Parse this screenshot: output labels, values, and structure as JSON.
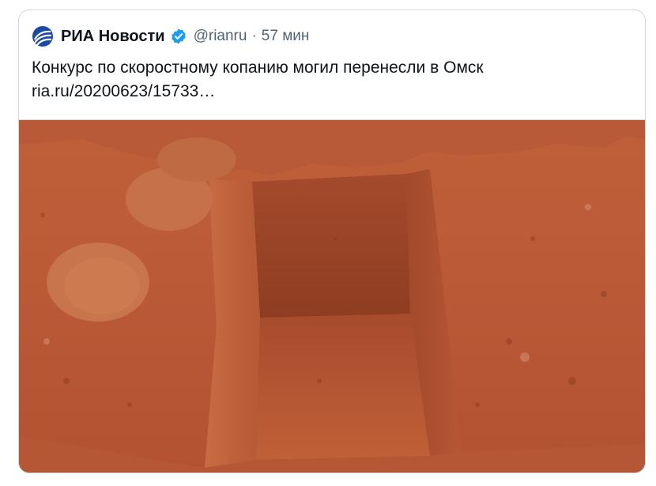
{
  "tweet": {
    "author_name": "РИА Новости",
    "author_handle": "@rianru",
    "separator": "·",
    "timestamp": "57 мин",
    "text_line1": "Конкурс по скоростному копанию могил перенесли в Омск",
    "text_line2": "ria.ru/20200623/15733…",
    "verified_icon": "verified-badge-icon",
    "avatar_icon": "ria-logo-icon"
  },
  "colors": {
    "name": "#0f1419",
    "secondary": "#536471",
    "verified": "#1d9bf0",
    "logo": "#1a4aa5",
    "border": "#cfd9de"
  }
}
